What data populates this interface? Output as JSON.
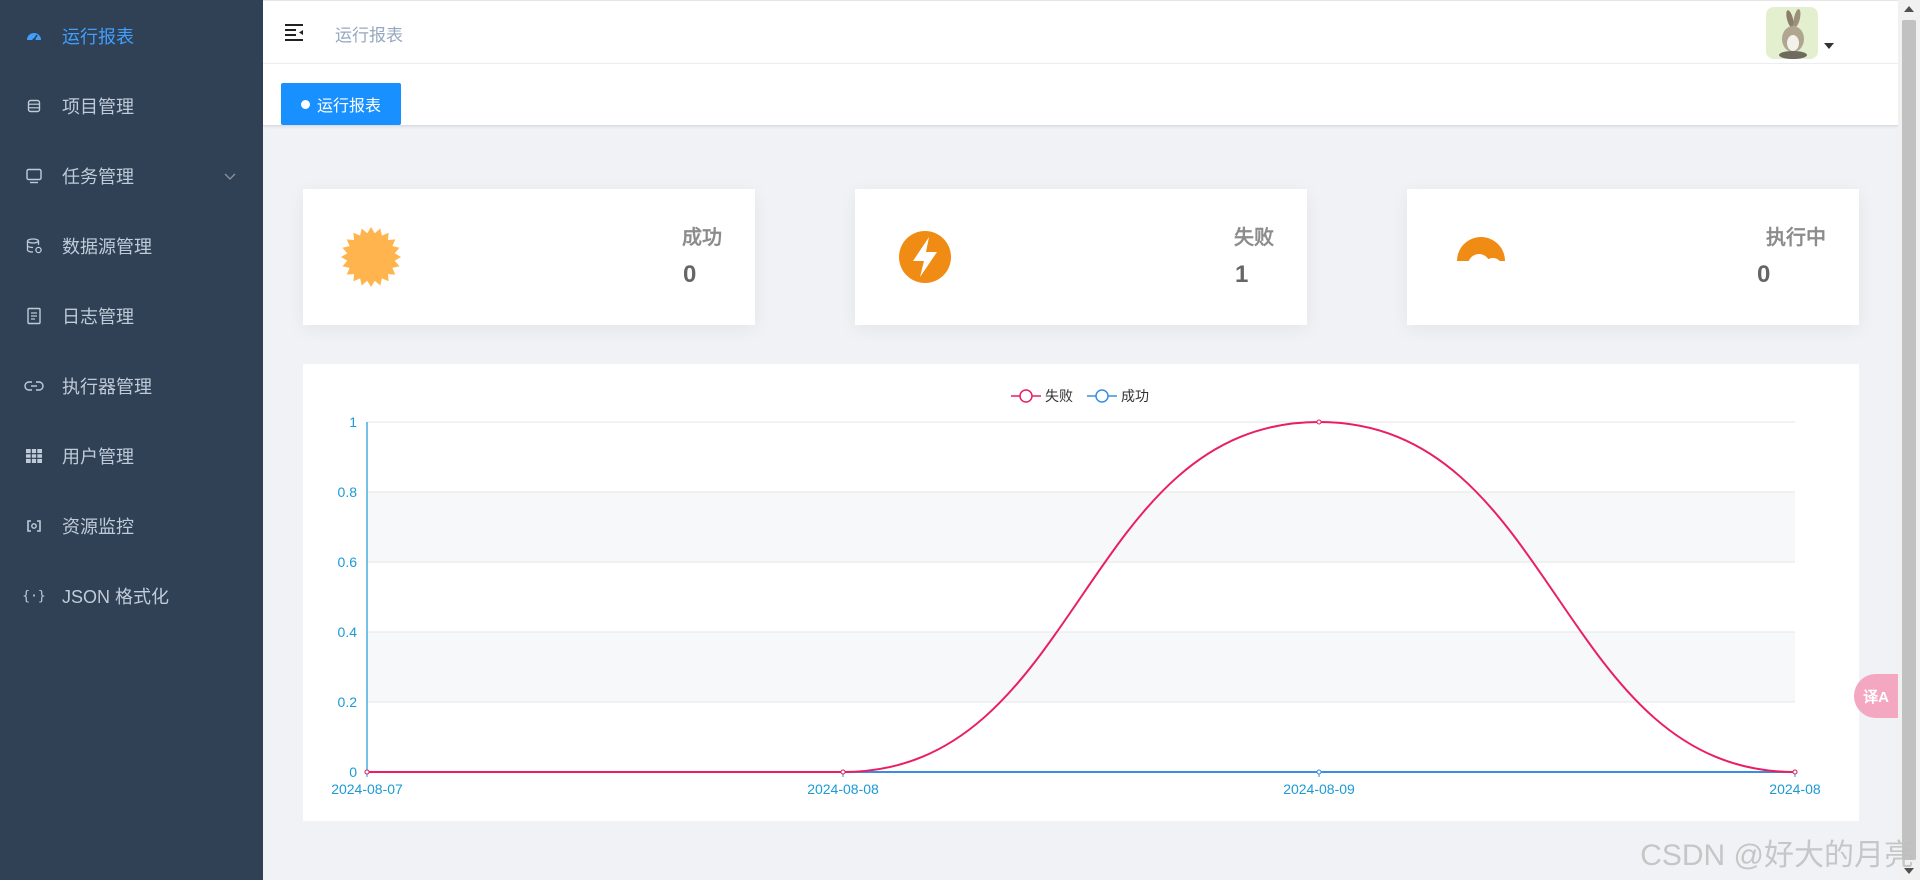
{
  "sidebar": {
    "items": [
      {
        "label": "运行报表",
        "icon": "dashboard-icon",
        "active": true
      },
      {
        "label": "项目管理",
        "icon": "database-icon"
      },
      {
        "label": "任务管理",
        "icon": "monitor-icon",
        "has_children": true
      },
      {
        "label": "数据源管理",
        "icon": "datasource-icon"
      },
      {
        "label": "日志管理",
        "icon": "document-icon"
      },
      {
        "label": "执行器管理",
        "icon": "link-icon"
      },
      {
        "label": "用户管理",
        "icon": "table-icon"
      },
      {
        "label": "资源监控",
        "icon": "monitor-link-icon"
      },
      {
        "label": "JSON 格式化",
        "icon": "braces-icon"
      }
    ]
  },
  "navbar": {
    "breadcrumb": "运行报表",
    "avatar_icon": "avatar-bunny-icon"
  },
  "tags": {
    "active": "运行报表"
  },
  "cards": [
    {
      "label": "成功",
      "value": "0",
      "icon": "sun-icon",
      "color": "#ffb44d"
    },
    {
      "label": "失败",
      "value": "1",
      "icon": "lightning-icon",
      "color": "#f08c14"
    },
    {
      "label": "执行中",
      "value": "0",
      "icon": "cloud-sun-icon",
      "color": "#f08c14"
    }
  ],
  "chart_data": {
    "type": "line",
    "x": [
      "2024-08-07",
      "2024-08-08",
      "2024-08-09",
      "2024-08"
    ],
    "series": [
      {
        "name": "失败",
        "values": [
          0,
          0,
          1,
          0
        ],
        "color": "#e91e63"
      },
      {
        "name": "成功",
        "values": [
          0,
          0,
          0,
          0
        ],
        "color": "#3b8de0"
      }
    ],
    "y_ticks": [
      "0",
      "0.2",
      "0.4",
      "0.6",
      "0.8",
      "1"
    ],
    "ylim": [
      0,
      1
    ],
    "smooth": true,
    "legend_position": "top-center",
    "axis_color": "#1a9ad6"
  },
  "watermark": "CSDN @好大的月亮",
  "translate_button": "译A"
}
